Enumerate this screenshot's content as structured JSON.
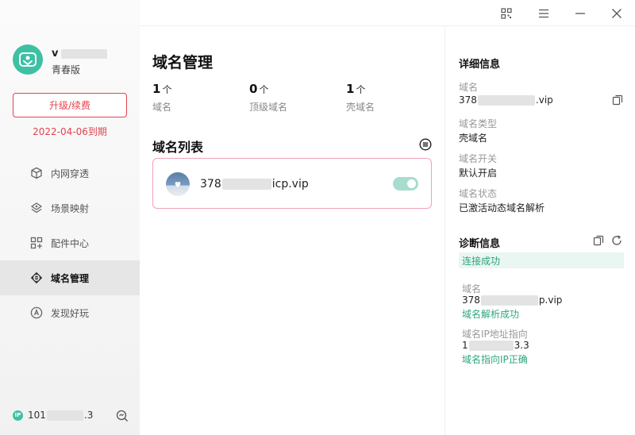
{
  "sidebar": {
    "username_prefix": "v",
    "edition": "青春版",
    "upgrade_label": "升级/续费",
    "expire_text": "2022-04-06到期",
    "nav": [
      {
        "label": "内网穿透",
        "icon": "cube-icon"
      },
      {
        "label": "场景映射",
        "icon": "layers-icon"
      },
      {
        "label": "配件中心",
        "icon": "grid-icon"
      },
      {
        "label": "域名管理",
        "icon": "domain-icon"
      },
      {
        "label": "发现好玩",
        "icon": "compass-icon"
      }
    ],
    "ip_prefix": "101",
    "ip_suffix": ".3"
  },
  "titlebar": {
    "buttons": [
      "qrcode-icon",
      "menu-icon",
      "minimize-icon",
      "close-icon"
    ]
  },
  "main": {
    "title": "域名管理",
    "stats": [
      {
        "num": "1",
        "unit": "个",
        "label": "域名"
      },
      {
        "num": "0",
        "unit": "个",
        "label": "顶级域名"
      },
      {
        "num": "1",
        "unit": "个",
        "label": "壳域名"
      }
    ],
    "list_title": "域名列表",
    "domains": [
      {
        "name_prefix": "378",
        "name_suffix": "icp.vip",
        "enabled": true
      }
    ]
  },
  "detail": {
    "title": "详细信息",
    "domain_key": "域名",
    "domain_prefix": "378",
    "domain_suffix": ".vip",
    "type_key": "域名类型",
    "type_val": "壳域名",
    "switch_key": "域名开关",
    "switch_val": "默认开启",
    "status_key": "域名状态",
    "status_val": "已激活动态域名解析"
  },
  "diagnosis": {
    "title": "诊断信息",
    "connect_status": "连接成功",
    "domain_key": "域名",
    "domain_prefix": "378",
    "domain_suffix": "p.vip",
    "resolve_status": "域名解析成功",
    "ip_key": "域名IP地址指向",
    "ip_prefix": "1",
    "ip_suffix": "3.3",
    "ip_status": "域名指向IP正确"
  },
  "colors": {
    "accent": "#3ec0a3",
    "danger": "#e2444e",
    "success": "#2ea57f",
    "card_border": "#f0a3b4"
  }
}
